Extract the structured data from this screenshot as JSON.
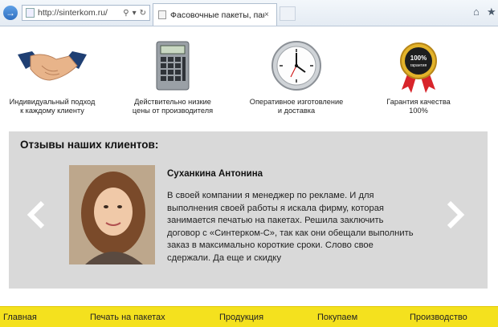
{
  "browser": {
    "url": "http://sinterkom.ru/",
    "tab_title": "Фасовочные пакеты, пакет…",
    "tab_close": "×",
    "nav_back": "→"
  },
  "features": [
    {
      "caption": "Индивидуальный подход\nк каждому клиенту",
      "icon": "handshake-icon"
    },
    {
      "caption": "Действительно низкие\nцены от производителя",
      "icon": "calculator-icon"
    },
    {
      "caption": "Оперативное изготовление\nи доставка",
      "icon": "clock-icon"
    },
    {
      "caption": "Гарантия качества\n100%",
      "icon": "quality-badge-icon",
      "badge_top": "100%",
      "badge_bottom": "гарантия"
    }
  ],
  "reviews": {
    "title": "Отзывы наших клиентов:",
    "reviewer_name": "Суханкина Антонина",
    "text": "В своей компании я менеджер по рекламе. И для выполнения своей работы я искала фирму, которая занимается печатью на пакетах. Решила заключить договор с «Синтерком-С», так как они обещали выполнить заказ в максимально короткие сроки. Слово свое сдержали. Да еще и скидку"
  },
  "menu": {
    "items": [
      "Главная",
      "Печать на пакетах",
      "Продукция",
      "Покупаем",
      "Производство"
    ]
  },
  "colors": {
    "menu_bg": "#f4e11e",
    "reviews_bg": "#d9d9d9"
  }
}
